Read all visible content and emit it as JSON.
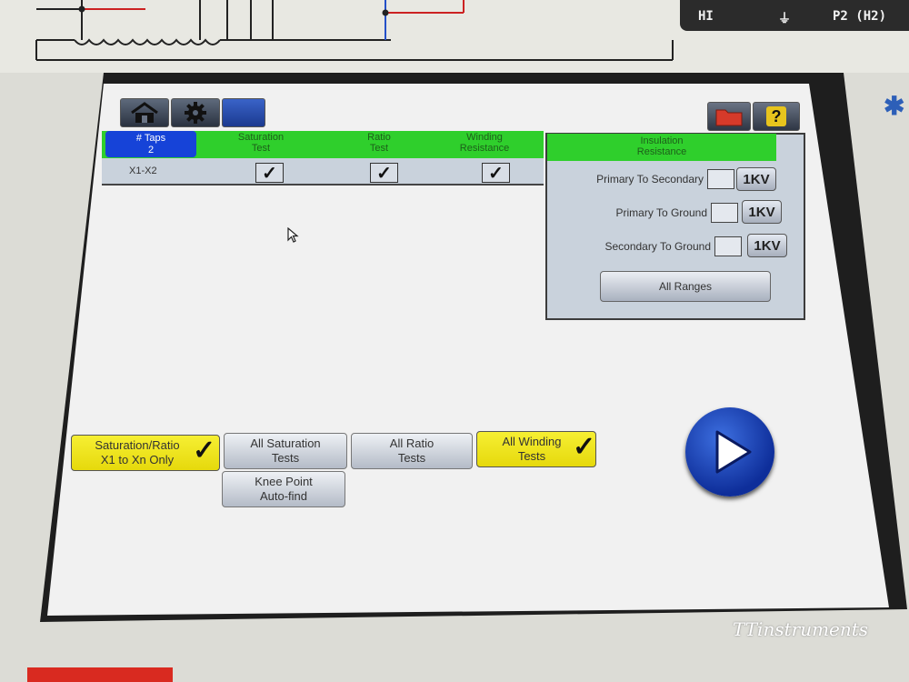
{
  "housing": {
    "terminals": [
      "HI",
      "⏚",
      "P2 (H2)"
    ],
    "brand_watermark": "TTinstruments"
  },
  "toolbar": {
    "home_icon": "home-icon",
    "settings_icon": "gear-icon",
    "folder_icon": "folder-icon",
    "help_label": "?"
  },
  "test_table": {
    "taps_header": "# Taps",
    "taps_value": "2",
    "columns": [
      "Saturation\nTest",
      "Ratio\nTest",
      "Winding\nResistance"
    ],
    "rows": [
      {
        "label": "X1-X2",
        "saturation": true,
        "ratio": true,
        "winding": true
      }
    ]
  },
  "insulation": {
    "header": "Insulation\nResistance",
    "items": [
      {
        "label": "Primary To Secondary",
        "checked": false,
        "button": "1KV"
      },
      {
        "label": "Primary To Ground",
        "checked": false,
        "button": "1KV"
      },
      {
        "label": "Secondary To Ground",
        "checked": false,
        "button": "1KV"
      }
    ],
    "all_ranges_label": "All Ranges"
  },
  "options": {
    "sat_ratio_x1": {
      "line1": "Saturation/Ratio",
      "line2": "X1 to Xn Only",
      "selected": true
    },
    "all_saturation": {
      "line1": "All Saturation",
      "line2": "Tests",
      "selected": false
    },
    "all_ratio": {
      "line1": "All Ratio",
      "line2": "Tests",
      "selected": false
    },
    "all_winding": {
      "line1": "All Winding",
      "line2": "Tests",
      "selected": true
    },
    "knee_point": {
      "line1": "Knee Point",
      "line2": "Auto-find",
      "selected": false
    }
  },
  "colors": {
    "header_green": "#2fcf2c",
    "selected_blue": "#1643d8",
    "selected_yellow": "#f2e81f",
    "play_blue": "#1c44c0"
  },
  "check_glyph": "✓"
}
